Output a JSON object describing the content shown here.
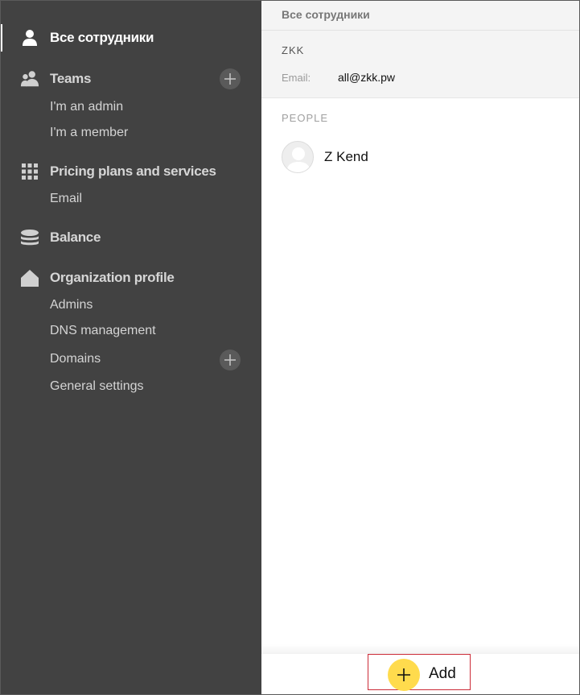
{
  "sidebar": {
    "all_employees": "Все сотрудники",
    "teams": "Teams",
    "teams_admin": "I'm an admin",
    "teams_member": "I'm a member",
    "pricing": "Pricing plans and services",
    "email": "Email",
    "balance": "Balance",
    "org_profile": "Organization profile",
    "admins": "Admins",
    "dns": "DNS management",
    "domains": "Domains",
    "general_settings": "General settings"
  },
  "content": {
    "header_title": "Все сотрудники",
    "org_name": "ZKK",
    "email_label": "Email:",
    "email_value": "all@zkk.pw",
    "people_title": "PEOPLE",
    "people": [
      {
        "name": "Z Kend"
      }
    ]
  },
  "actions": {
    "add_label": "Add"
  },
  "colors": {
    "sidebar_bg": "#424242",
    "accent_yellow": "#ffdb4d",
    "highlight_border": "#cc2b38"
  }
}
